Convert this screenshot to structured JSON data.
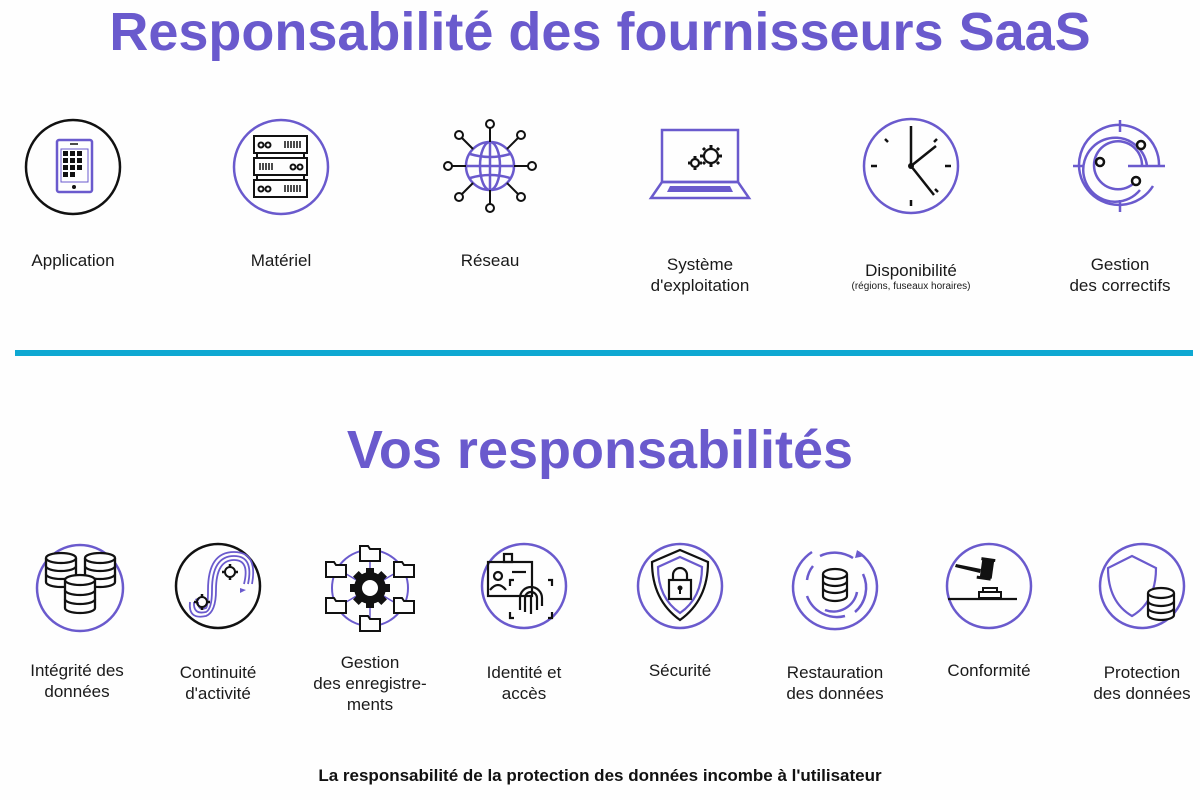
{
  "colors": {
    "accent": "#6a5acd",
    "divider": "#0ea8d2",
    "icon_stroke": "#111111",
    "text": "#1a1a1a"
  },
  "provider_section": {
    "title": "Responsabilité des fournisseurs SaaS",
    "items": [
      {
        "icon": "tablet-icon",
        "label": "Application"
      },
      {
        "icon": "server-rack-icon",
        "label": "Matériel"
      },
      {
        "icon": "network-globe-icon",
        "label": "Réseau"
      },
      {
        "icon": "laptop-gears-icon",
        "label_line1": "Système",
        "label_line2": "d'exploitation"
      },
      {
        "icon": "clock-icon",
        "label": "Disponibilité",
        "sublabel": "(régions, fuseaux horaires)"
      },
      {
        "icon": "patch-target-icon",
        "label_line1": "Gestion",
        "label_line2": "des correctifs"
      }
    ]
  },
  "user_section": {
    "title": "Vos responsabilités",
    "items": [
      {
        "icon": "databases-icon",
        "label_line1": "Intégrité des",
        "label_line2": "données"
      },
      {
        "icon": "continuity-gears-icon",
        "label_line1": "Continuité",
        "label_line2": "d'activité"
      },
      {
        "icon": "folders-gear-icon",
        "label_line1": "Gestion",
        "label_line2": "des enregistre-",
        "label_line3": "ments"
      },
      {
        "icon": "id-fingerprint-icon",
        "label_line1": "Identité et",
        "label_line2": "accès"
      },
      {
        "icon": "shield-lock-icon",
        "label": "Sécurité"
      },
      {
        "icon": "database-restore-icon",
        "label_line1": "Restauration",
        "label_line2": "des données"
      },
      {
        "icon": "gavel-icon",
        "label": "Conformité"
      },
      {
        "icon": "shield-database-icon",
        "label_line1": "Protection",
        "label_line2": "des données"
      }
    ]
  },
  "footer": {
    "text": "La responsabilité de la protection des données incombe à l'utilisateur"
  }
}
